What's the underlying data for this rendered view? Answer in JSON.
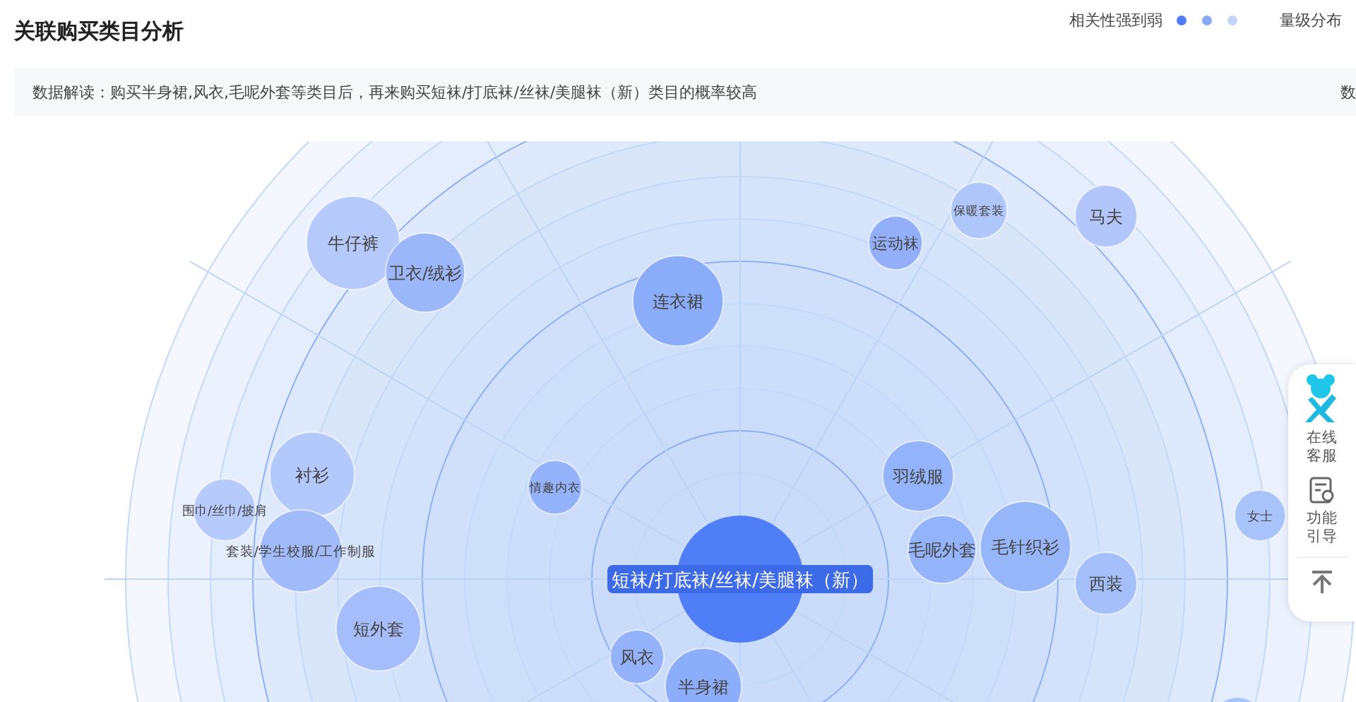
{
  "title": "关联购买类目分析",
  "legend": {
    "label": "相关性强到弱",
    "dots": [
      {
        "color": "#4f7ef7"
      },
      {
        "color": "#8aa9f8"
      },
      {
        "color": "#c3d3fb"
      }
    ]
  },
  "distribution_label": "量级分布",
  "interpretation": "数据解读：购买半身裙,风衣,毛呢外套等类目后，再来购买短袜/打底袜/丝袜/美腿袜（新）类目的概率较高",
  "interpretation_cut": "数",
  "chart": {
    "center": {
      "label": "短袜/打底袜/丝袜/美腿袜（新）",
      "color": "#4f7ef7"
    },
    "bubbles": [
      {
        "label": "牛仔裤",
        "color": "#b6c9fb"
      },
      {
        "label": "卫衣/绒衫",
        "color": "#9cb6fa"
      },
      {
        "label": "连衣裙",
        "color": "#8aacf9"
      },
      {
        "label": "运动袜",
        "color": "#93aff9"
      },
      {
        "label": "保暖套装",
        "color": "#afc6fb"
      },
      {
        "label": "马夫",
        "color": "#b3c6fb"
      },
      {
        "label": "衬衫",
        "color": "#b3c8fb"
      },
      {
        "label": "围巾/丝巾/披肩",
        "color": "#b6cafb"
      },
      {
        "label": "套装/学生校服/工作制服",
        "color": "#a0bafa"
      },
      {
        "label": "短外套",
        "color": "#a5bdfa"
      },
      {
        "label": "情趣内衣",
        "color": "#93b2fa"
      },
      {
        "label": "羽绒服",
        "color": "#93b3fa"
      },
      {
        "label": "毛呢外套",
        "color": "#93b3fa"
      },
      {
        "label": "毛针织衫",
        "color": "#97b6fa"
      },
      {
        "label": "西装",
        "color": "#a5bffa"
      },
      {
        "label": "风衣",
        "color": "#93b2fa"
      },
      {
        "label": "半身裙",
        "color": "#8cadf9"
      },
      {
        "label": "女士",
        "color": "#a9c3fb"
      }
    ]
  },
  "side_panel": {
    "items": [
      {
        "kind": "service",
        "label": "在线客服"
      },
      {
        "kind": "guide",
        "label": "功能引导"
      },
      {
        "kind": "top"
      }
    ]
  }
}
